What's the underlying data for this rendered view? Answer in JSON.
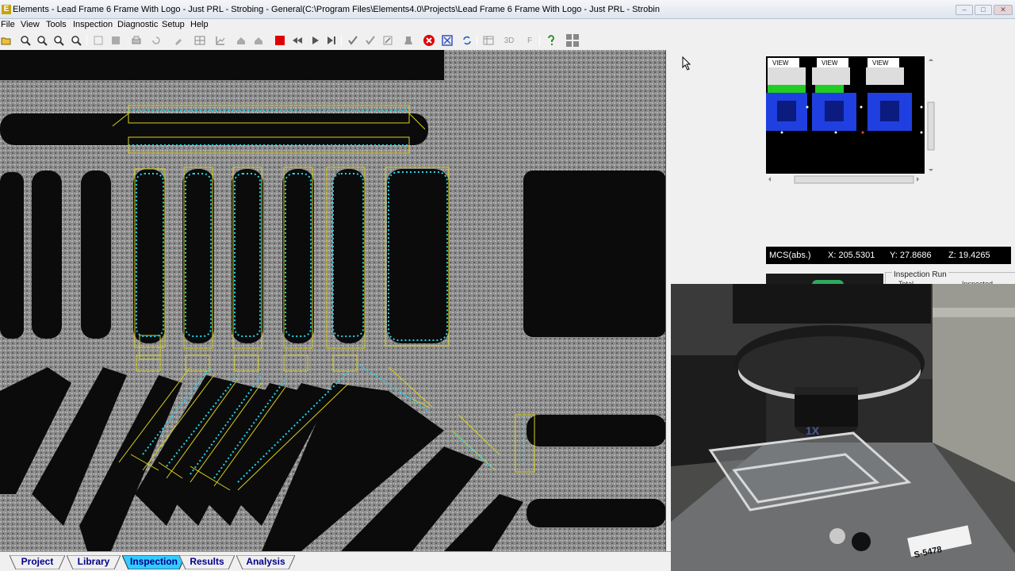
{
  "window": {
    "app_letter": "E",
    "title": "Elements - Lead Frame 6 Frame With Logo - Just PRL - Strobing - General(C:\\Program Files\\Elements4.0\\Projects\\Lead Frame 6 Frame With Logo - Just PRL - Strobin",
    "minimize": "–",
    "maximize": "□",
    "close": "✕"
  },
  "menu": [
    "File",
    "View",
    "Tools",
    "Inspection",
    "Diagnostic",
    "Setup",
    "Help"
  ],
  "toolbar": {
    "icons": [
      "open-icon",
      "zoom-in-icon",
      "zoom-out-icon",
      "zoom-fit-icon",
      "zoom-window-icon",
      "copy-icon",
      "stop-gray-icon",
      "print-icon",
      "refresh-icon",
      "tool-icon",
      "grid-icon",
      "graph-icon",
      "home-icon",
      "home-alt-icon",
      "stop-red-icon",
      "rewind-icon",
      "play-icon",
      "skip-end-icon",
      "check-icon",
      "check-edit-icon",
      "edit-icon",
      "fixture-icon",
      "abort-icon",
      "target-icon",
      "cycle-icon",
      "table-icon",
      "3d-icon",
      "f-icon",
      "help-icon",
      "windows-icon"
    ],
    "label_3d": "3D",
    "label_f": "F",
    "colors": {
      "stop": "#e00000",
      "abort": "#e00000",
      "target": "#3050c0",
      "help": "#2f8f2f"
    }
  },
  "minimap": {
    "view_labels": [
      "VIEW",
      "VIEW",
      "VIEW"
    ],
    "colors": {
      "lead": "#1f3fe0",
      "band": "#22cc22",
      "background": "#000000"
    }
  },
  "coords": {
    "frame": "MCS(abs.)",
    "x": "X: 205.5301",
    "y": "Y: 27.8686",
    "z": "Z: 19.4265"
  },
  "inspection_run": {
    "title": "Inspection Run",
    "total_label": "Total",
    "inspected_label": "Inspected"
  },
  "video": {
    "lens_label": "1X",
    "tag_label": "S-5478"
  },
  "tabs": [
    {
      "label": "Project",
      "active": false
    },
    {
      "label": "Library",
      "active": false
    },
    {
      "label": "Inspection",
      "active": true
    },
    {
      "label": "Results",
      "active": false
    },
    {
      "label": "Analysis",
      "active": false
    }
  ],
  "colors": {
    "edge_points": "#22d3e8",
    "tolerance_box": "#d8d21a",
    "active_tab": "#33ccff"
  }
}
